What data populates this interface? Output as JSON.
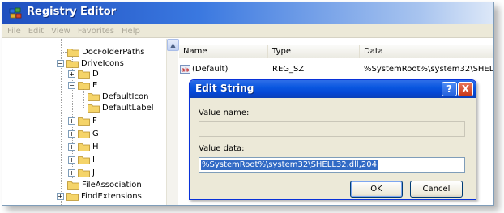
{
  "window": {
    "title": "Registry Editor"
  },
  "menu": [
    "File",
    "Edit",
    "View",
    "Favorites",
    "Help"
  ],
  "tree": {
    "items": [
      {
        "label": "DocFolderPaths"
      },
      {
        "label": "DriveIcons"
      },
      {
        "label": "D"
      },
      {
        "label": "E"
      },
      {
        "label": "DefaultIcon"
      },
      {
        "label": "DefaultLabel"
      },
      {
        "label": "F"
      },
      {
        "label": "G"
      },
      {
        "label": "H"
      },
      {
        "label": "I"
      },
      {
        "label": "J"
      },
      {
        "label": "FileAssociation"
      },
      {
        "label": "FindExtensions"
      }
    ]
  },
  "list": {
    "columns": [
      "Name",
      "Type",
      "Data"
    ],
    "rows": [
      {
        "name": "(Default)",
        "type": "REG_SZ",
        "data": "%SystemRoot%\\system32\\SHEL"
      }
    ]
  },
  "dialog": {
    "title": "Edit String",
    "help_glyph": "?",
    "close_glyph": "X",
    "value_name_label": "Value name:",
    "value_name": "",
    "value_data_label": "Value data:",
    "value_data": "%SystemRoot%\\system32\\SHELL32.dll,204",
    "ok_label": "OK",
    "cancel_label": "Cancel"
  },
  "colors": {
    "title_bar": "#3a78e0",
    "dialog_title": "#0548d6",
    "selection": "#316ac5",
    "dialog_face": "#ece9d8"
  }
}
